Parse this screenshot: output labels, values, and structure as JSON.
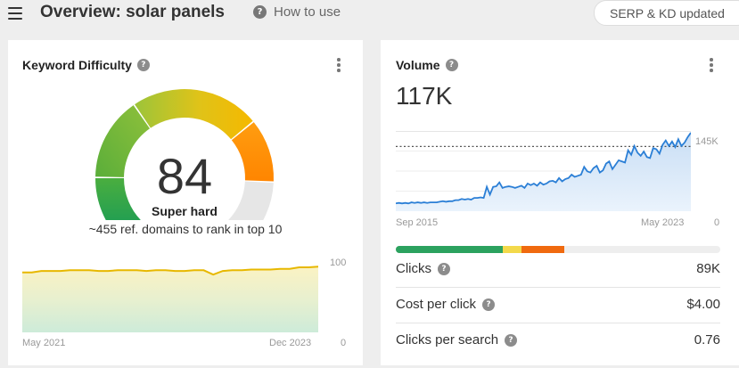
{
  "header": {
    "title": "Overview: solar panels",
    "how_to_use": "How to use",
    "serp_button": "SERP & KD updated"
  },
  "kd_card": {
    "title": "Keyword Difficulty",
    "value": "84",
    "label": "Super hard",
    "description": "~455 ref. domains to rank in top 10",
    "chart": {
      "x_start": "May 2021",
      "x_end": "Dec 2023",
      "y_top": "100",
      "y_bottom": "0"
    }
  },
  "volume_card": {
    "title": "Volume",
    "value": "117K",
    "chart": {
      "x_start": "Sep 2015",
      "x_end": "May 2023",
      "y_top": "145K",
      "y_bottom": "0"
    },
    "metrics": [
      {
        "label": "Clicks",
        "value": "89K"
      },
      {
        "label": "Cost per click",
        "value": "$4.00"
      },
      {
        "label": "Clicks per search",
        "value": "0.76"
      }
    ]
  },
  "colors": {
    "accent_blue": "#2b7fd6",
    "kd_line": "#e7b800",
    "green": "#2ca25f",
    "yellow": "#f3d94b",
    "orange": "#f06a0f"
  },
  "chart_data": [
    {
      "type": "line",
      "series": [
        {
          "values": [
            82,
            82,
            84,
            84,
            84,
            85,
            85,
            85,
            84,
            84,
            85,
            85,
            85,
            84,
            85,
            85,
            84,
            84,
            85,
            85,
            79,
            84,
            85,
            85,
            86,
            86,
            86,
            87,
            87,
            89,
            89,
            90
          ]
        }
      ],
      "x_start": "May 2021",
      "x_end": "Dec 2023",
      "ylim": [
        0,
        100
      ],
      "grid": false
    },
    {
      "type": "area",
      "series": [
        {
          "values": [
            14,
            15,
            14,
            15,
            14,
            16,
            15,
            16,
            15,
            16,
            15,
            16,
            16,
            16,
            17,
            18,
            17,
            18,
            18,
            20,
            20,
            22,
            21,
            22,
            21,
            24,
            24,
            25,
            24,
            44,
            30,
            44,
            45,
            52,
            42,
            44,
            45,
            44,
            42,
            44,
            46,
            42,
            50,
            47,
            50,
            46,
            52,
            48,
            50,
            54,
            55,
            52,
            60,
            54,
            58,
            60,
            66,
            62,
            64,
            66,
            80,
            72,
            70,
            78,
            82,
            70,
            74,
            86,
            90,
            76,
            84,
            92,
            90,
            88,
            110,
            102,
            118,
            106,
            100,
            108,
            98,
            96,
            114,
            112,
            104,
            120,
            128,
            118,
            126,
            116,
            130,
            118,
            124,
            134,
            142
          ]
        }
      ],
      "x_start": "Sep 2015",
      "x_end": "May 2023",
      "ylim": [
        0,
        145
      ],
      "reference_line": 117,
      "grid": true
    }
  ]
}
